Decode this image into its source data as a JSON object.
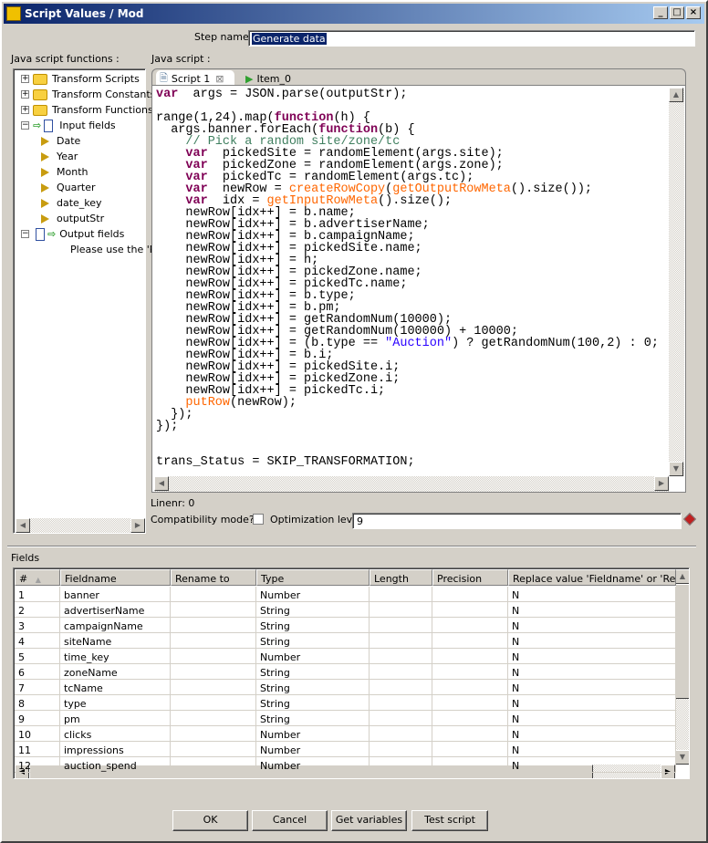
{
  "window": {
    "title": "Script Values / Mod",
    "controls": [
      "_",
      "□",
      "×"
    ]
  },
  "step": {
    "label": "Step name",
    "value": "Generate data"
  },
  "functions": {
    "label": "Java script functions :",
    "tree": [
      {
        "label": "Transform Scripts",
        "kind": "folder",
        "expander": "+"
      },
      {
        "label": "Transform Constants",
        "kind": "folder",
        "expander": "+"
      },
      {
        "label": "Transform Functions",
        "kind": "folder",
        "expander": "+"
      },
      {
        "label": "Input fields",
        "kind": "input",
        "expander": "−"
      },
      {
        "label": "Date",
        "kind": "field"
      },
      {
        "label": "Year",
        "kind": "field"
      },
      {
        "label": "Month",
        "kind": "field"
      },
      {
        "label": "Quarter",
        "kind": "field"
      },
      {
        "label": "date_key",
        "kind": "field"
      },
      {
        "label": "outputStr",
        "kind": "field"
      },
      {
        "label": "Output fields",
        "kind": "output",
        "expander": "−"
      },
      {
        "label": "Please use the 'Re",
        "kind": "note"
      }
    ]
  },
  "script": {
    "label": "Java script :",
    "tabs": [
      {
        "label": "Script 1",
        "active": true
      },
      {
        "label": "Item_0",
        "active": false
      }
    ],
    "code": [
      [
        [
          "kw",
          "var"
        ],
        [
          "",
          "  args = JSON.parse(outputStr);"
        ]
      ],
      [],
      [
        [
          "",
          "range(1,24).map("
        ],
        [
          "kw",
          "function"
        ],
        [
          "",
          "(h) {"
        ]
      ],
      [
        [
          "",
          "  args.banner.forEach("
        ],
        [
          "kw",
          "function"
        ],
        [
          "",
          "(b) {"
        ]
      ],
      [
        [
          "cm",
          "    // Pick a random site/zone/tc"
        ]
      ],
      [
        [
          "kw",
          "    var"
        ],
        [
          "",
          "  pickedSite = randomElement(args.site);"
        ]
      ],
      [
        [
          "kw",
          "    var"
        ],
        [
          "",
          "  pickedZone = randomElement(args.zone);"
        ]
      ],
      [
        [
          "kw",
          "    var"
        ],
        [
          "",
          "  pickedTc = randomElement(args.tc);"
        ]
      ],
      [
        [
          "kw",
          "    var"
        ],
        [
          "",
          "  newRow = "
        ],
        [
          "fn",
          "createRowCopy"
        ],
        [
          "",
          "("
        ],
        [
          "fn",
          "getOutputRowMeta"
        ],
        [
          "",
          "().size());"
        ]
      ],
      [
        [
          "kw",
          "    var"
        ],
        [
          "",
          "  idx = "
        ],
        [
          "fn",
          "getInputRowMeta"
        ],
        [
          "",
          "().size();"
        ]
      ],
      [
        [
          "",
          "    newRow[idx++] = b.name;"
        ]
      ],
      [
        [
          "",
          "    newRow[idx++] = b.advertiserName;"
        ]
      ],
      [
        [
          "",
          "    newRow[idx++] = b.campaignName;"
        ]
      ],
      [
        [
          "",
          "    newRow[idx++] = pickedSite.name;"
        ]
      ],
      [
        [
          "",
          "    newRow[idx++] = h;"
        ]
      ],
      [
        [
          "",
          "    newRow[idx++] = pickedZone.name;"
        ]
      ],
      [
        [
          "",
          "    newRow[idx++] = pickedTc.name;"
        ]
      ],
      [
        [
          "",
          "    newRow[idx++] = b.type;"
        ]
      ],
      [
        [
          "",
          "    newRow[idx++] = b.pm;"
        ]
      ],
      [
        [
          "",
          "    newRow[idx++] = getRandomNum(10000);"
        ]
      ],
      [
        [
          "",
          "    newRow[idx++] = getRandomNum(100000) + 10000;"
        ]
      ],
      [
        [
          "",
          "    newRow[idx++] = (b.type == "
        ],
        [
          "st",
          "\"Auction\""
        ],
        [
          "",
          ") ? getRandomNum(100,2) : 0;"
        ]
      ],
      [
        [
          "",
          "    newRow[idx++] = b.i;"
        ]
      ],
      [
        [
          "",
          "    newRow[idx++] = pickedSite.i;"
        ]
      ],
      [
        [
          "",
          "    newRow[idx++] = pickedZone.i;"
        ]
      ],
      [
        [
          "",
          "    newRow[idx++] = pickedTc.i;"
        ]
      ],
      [
        [
          "fn",
          "    putRow"
        ],
        [
          "",
          "(newRow);"
        ]
      ],
      [
        [
          "",
          "  });"
        ]
      ],
      [
        [
          "",
          "});"
        ]
      ],
      [],
      [],
      [
        [
          "",
          "trans_Status = SKIP_TRANSFORMATION;"
        ]
      ]
    ],
    "linenr": "Linenr: 0",
    "compat_label": "Compatibility mode?",
    "compat_checked": false,
    "opt_label": "Optimization level",
    "opt_value": "9"
  },
  "fields": {
    "label": "Fields",
    "columns": [
      "#",
      "Fieldname",
      "Rename to",
      "Type",
      "Length",
      "Precision",
      "Replace value 'Fieldname' or 'Rename"
    ],
    "rows": [
      [
        "1",
        "banner",
        "",
        "Number",
        "",
        "",
        "N"
      ],
      [
        "2",
        "advertiserName",
        "",
        "String",
        "",
        "",
        "N"
      ],
      [
        "3",
        "campaignName",
        "",
        "String",
        "",
        "",
        "N"
      ],
      [
        "4",
        "siteName",
        "",
        "String",
        "",
        "",
        "N"
      ],
      [
        "5",
        "time_key",
        "",
        "Number",
        "",
        "",
        "N"
      ],
      [
        "6",
        "zoneName",
        "",
        "String",
        "",
        "",
        "N"
      ],
      [
        "7",
        "tcName",
        "",
        "String",
        "",
        "",
        "N"
      ],
      [
        "8",
        "type",
        "",
        "String",
        "",
        "",
        "N"
      ],
      [
        "9",
        "pm",
        "",
        "String",
        "",
        "",
        "N"
      ],
      [
        "10",
        "clicks",
        "",
        "Number",
        "",
        "",
        "N"
      ],
      [
        "11",
        "impressions",
        "",
        "Number",
        "",
        "",
        "N"
      ],
      [
        "12",
        "auction_spend",
        "",
        "Number",
        "",
        "",
        "N"
      ]
    ]
  },
  "buttons": {
    "ok": "OK",
    "cancel": "Cancel",
    "get_variables": "Get variables",
    "test_script": "Test script"
  }
}
